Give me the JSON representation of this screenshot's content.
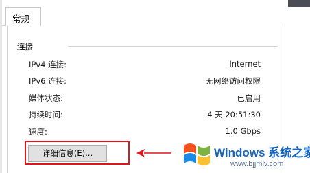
{
  "tab": {
    "label": "常规"
  },
  "connection": {
    "group_label": "连接",
    "rows": [
      {
        "label": "IPv4 连接:",
        "value": "Internet"
      },
      {
        "label": "IPv6 连接:",
        "value": "无网络访问权限"
      },
      {
        "label": "媒体状态:",
        "value": "已启用"
      },
      {
        "label": "持续时间:",
        "value": "4 天 20:51:30"
      },
      {
        "label": "速度:",
        "value": "1.0 Gbps"
      }
    ]
  },
  "buttons": {
    "details_label": "详细信息(E)..."
  },
  "annotation": {
    "highlight_color": "#e0141a",
    "arrow_color": "#e0141a"
  },
  "watermark": {
    "title": "Windows 系统之家",
    "url": "www.bjjmlv.com",
    "logo_icon": "windows-logo-icon",
    "colors": {
      "text": "#1565c0",
      "logo_blue": "#1e88e5",
      "logo_green": "#7cb342",
      "logo_orange": "#f4511e",
      "logo_yellow": "#fbc02d"
    }
  }
}
